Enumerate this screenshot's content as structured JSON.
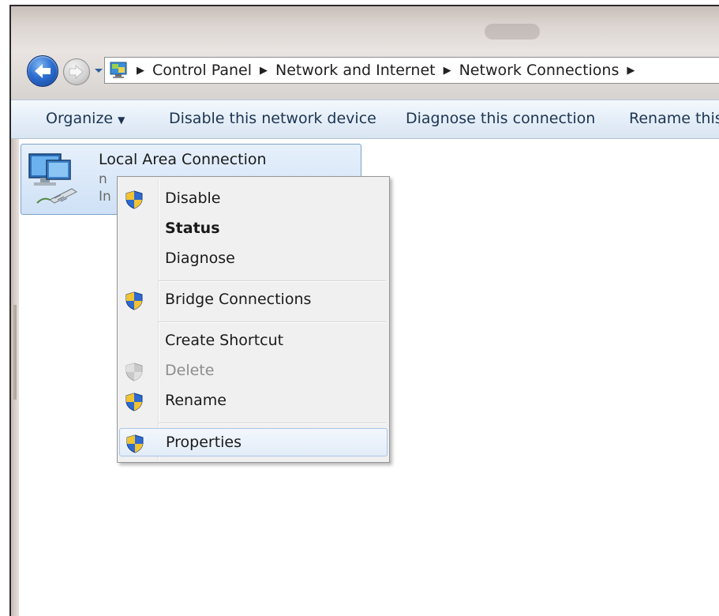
{
  "address": {
    "breadcrumbs": [
      "Control Panel",
      "Network and Internet",
      "Network Connections"
    ]
  },
  "toolbar": {
    "organize": "Organize",
    "disable": "Disable this network device",
    "diagnose": "Diagnose this connection",
    "rename": "Rename this"
  },
  "connection": {
    "name": "Local Area Connection",
    "line2_partial": "n",
    "line3_partial": "In"
  },
  "context_menu": {
    "disable": "Disable",
    "status": "Status",
    "diagnose": "Diagnose",
    "bridge": "Bridge Connections",
    "shortcut": "Create Shortcut",
    "delete": "Delete",
    "rename": "Rename",
    "properties": "Properties"
  },
  "icons": {
    "back": "back-arrow-icon",
    "forward": "forward-arrow-icon",
    "network": "network-adapter-icon",
    "uac": "uac-shield-icon"
  },
  "colors": {
    "accent": "#2d6fd0",
    "toolbar_text": "#1c3553",
    "selection": "#cfe1f6"
  }
}
